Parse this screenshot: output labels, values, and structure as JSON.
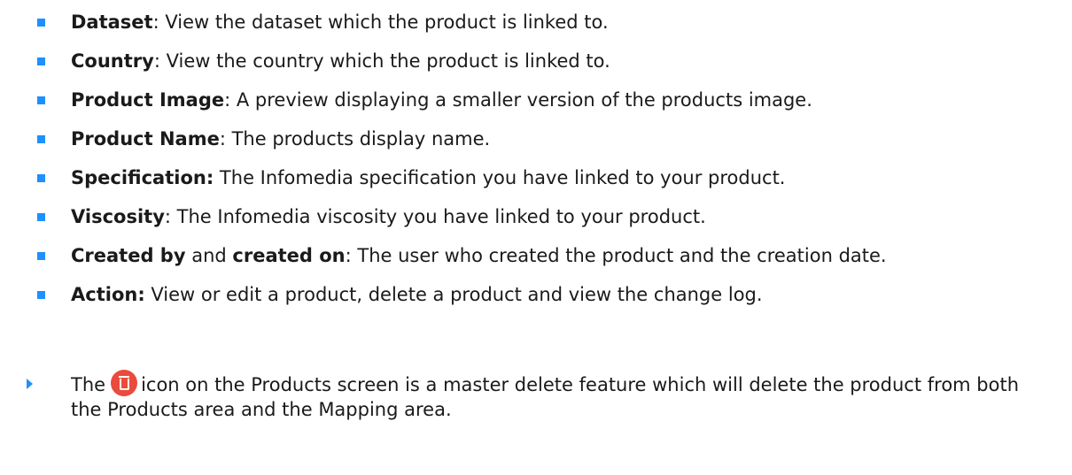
{
  "fields": [
    {
      "term": "Dataset",
      "separator": ":",
      "description": " View the dataset which the product is linked to."
    },
    {
      "term": "Country",
      "separator": ":",
      "description": " View the country which the product is linked to."
    },
    {
      "term": "Product Image",
      "separator": ":",
      "description": " A preview displaying a smaller version of the products image."
    },
    {
      "term": "Product Name",
      "separator": ":",
      "description": " The products display name."
    },
    {
      "term": "Specification:",
      "separator": "",
      "description": " The Infomedia specification you have linked to your product."
    },
    {
      "term": "Viscosity",
      "separator": ":",
      "description": " The Infomedia viscosity you have linked to your product."
    },
    {
      "term": "Created by",
      "connector": " and ",
      "term2": "created on",
      "separator": ":",
      "description": " The user who created the product and the creation date."
    },
    {
      "term": "Action:",
      "separator": "",
      "description": " View or edit a product, delete a product and view the change log."
    }
  ],
  "tip": {
    "before_icon": "The",
    "icon": "delete-icon",
    "icon_color": "#ea4b3c",
    "after_icon": "icon on the Products screen is a master delete feature which will delete the product from both the Products area and the Mapping area."
  },
  "colors": {
    "bullet": "#1e90ff",
    "arrow": "#1e90ff",
    "text": "#1a1a1a"
  }
}
